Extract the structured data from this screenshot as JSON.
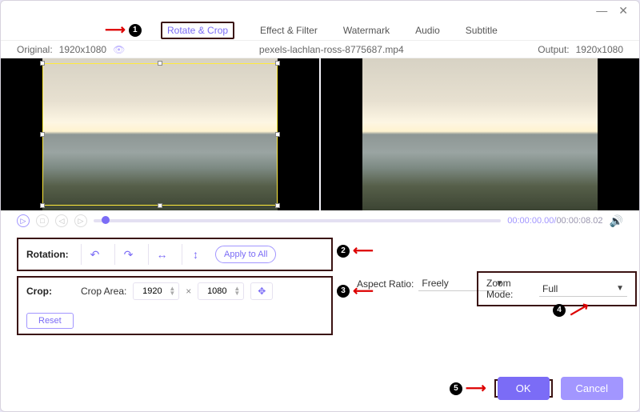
{
  "titlebar": {
    "min": "—",
    "close": "✕"
  },
  "tabs": {
    "rotate_crop": "Rotate & Crop",
    "effect_filter": "Effect & Filter",
    "watermark": "Watermark",
    "audio": "Audio",
    "subtitle": "Subtitle"
  },
  "info": {
    "original_label": "Original:",
    "original_res": "1920x1080",
    "filename": "pexels-lachlan-ross-8775687.mp4",
    "output_label": "Output:",
    "output_res": "1920x1080"
  },
  "playback": {
    "current": "00:00:00.00",
    "duration": "00:00:08.02"
  },
  "rotation": {
    "label": "Rotation:",
    "apply_all": "Apply to All",
    "icons": {
      "ccw": "rotate-ccw-icon",
      "cw": "rotate-cw-icon",
      "flip_h": "flip-horizontal-icon",
      "flip_v": "flip-vertical-icon"
    }
  },
  "crop": {
    "label": "Crop:",
    "area_label": "Crop Area:",
    "width": "1920",
    "height": "1080",
    "x": "×",
    "reset": "Reset"
  },
  "aspect": {
    "label": "Aspect Ratio:",
    "value": "Freely"
  },
  "zoom": {
    "label": "Zoom Mode:",
    "value": "Full"
  },
  "footer": {
    "ok": "OK",
    "cancel": "Cancel"
  },
  "ann": {
    "n1": "1",
    "n2": "2",
    "n3": "3",
    "n4": "4",
    "n5": "5"
  }
}
